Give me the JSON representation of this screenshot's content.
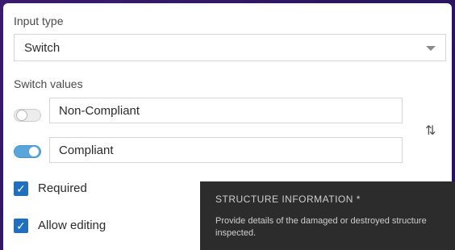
{
  "input_type": {
    "label": "Input type",
    "selected": "Switch"
  },
  "switch_values": {
    "label": "Switch values",
    "off_value": "Non-Compliant",
    "on_value": "Compliant",
    "swap_glyph": "⇅"
  },
  "options": {
    "required_label": "Required",
    "required_checked": true,
    "allow_editing_label": "Allow editing",
    "allow_editing_checked": true,
    "check_glyph": "✓"
  },
  "tooltip": {
    "title": "STRUCTURE INFORMATION *",
    "description": "Provide details of the damaged or destroyed structure inspected."
  },
  "colors": {
    "background": "#2a1660",
    "accent": "#1e6fc2",
    "toggle_on": "#5aa6db",
    "tooltip_bg": "#2c2c2c"
  }
}
